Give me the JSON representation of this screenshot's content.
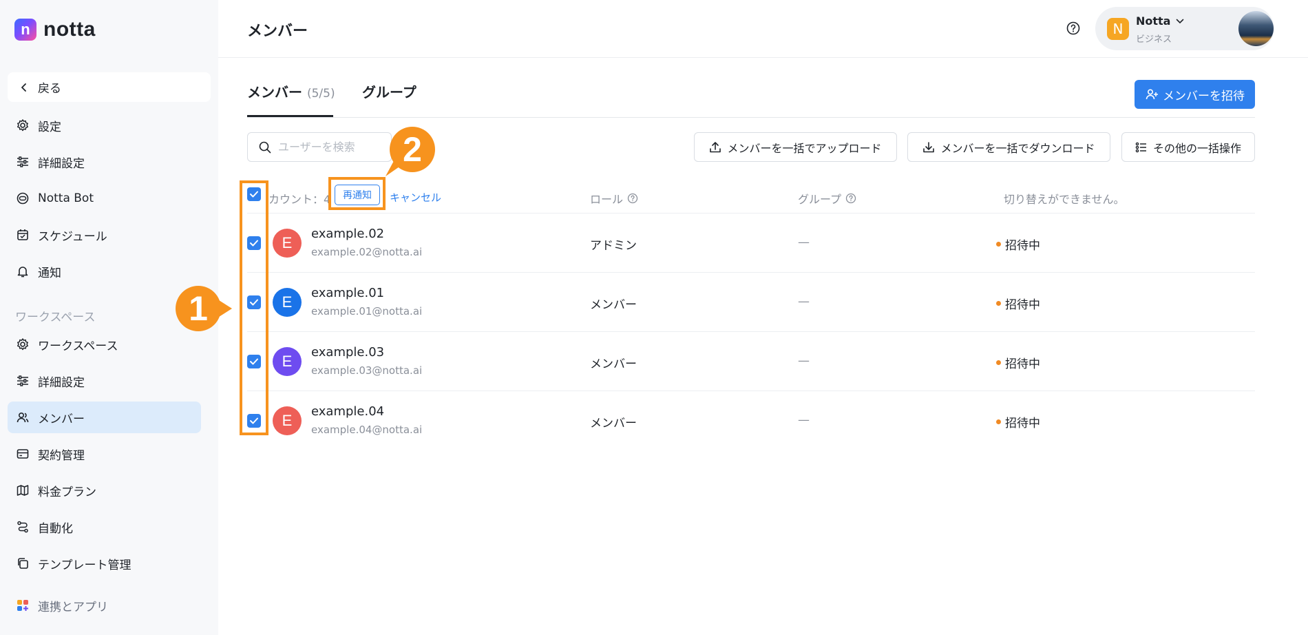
{
  "app": {
    "logo_letter": "n",
    "logo_text": "notta"
  },
  "sidebar": {
    "back_label": "戻る",
    "items": [
      {
        "label": "設定",
        "icon": "gear-icon"
      },
      {
        "label": "詳細設定",
        "icon": "sliders-icon"
      },
      {
        "label": "Notta Bot",
        "icon": "bot-icon"
      },
      {
        "label": "スケジュール",
        "icon": "calendar-icon"
      },
      {
        "label": "通知",
        "icon": "bell-icon"
      }
    ],
    "workspace_heading": "ワークスペース",
    "workspace_items": [
      {
        "label": "ワークスペース",
        "icon": "gear-icon"
      },
      {
        "label": "詳細設定",
        "icon": "sliders-icon"
      },
      {
        "label": "メンバー",
        "icon": "users-icon",
        "active": true
      },
      {
        "label": "契約管理",
        "icon": "card-icon"
      },
      {
        "label": "料金プラン",
        "icon": "map-icon"
      },
      {
        "label": "自動化",
        "icon": "flow-icon"
      },
      {
        "label": "テンプレート管理",
        "icon": "template-icon"
      }
    ],
    "integrations_label": "連携とアプリ"
  },
  "header": {
    "title": "メンバー",
    "account": {
      "name": "Notta",
      "plan": "ビジネス",
      "avatar_letter": "N"
    }
  },
  "tabs": {
    "members_label": "メンバー",
    "members_count": "(5/5)",
    "groups_label": "グループ"
  },
  "toolbar": {
    "invite_label": "メンバーを招待",
    "search_placeholder": "ユーザーを検索",
    "bulk_upload_label": "メンバーを一括でアップロード",
    "bulk_download_label": "メンバーを一括でダウンロード",
    "other_bulk_label": "その他の一括操作"
  },
  "table": {
    "selection": {
      "count_label": "カウント：4",
      "resend_label": "再通知",
      "cancel_label": "キャンセル"
    },
    "columns": {
      "role": "ロール",
      "group": "グループ",
      "status": "切り替えができません。"
    },
    "rows": [
      {
        "avatar_letter": "E",
        "avatar_color": "#ee5f57",
        "name": "example.02",
        "email": "example.02@notta.ai",
        "role": "アドミン",
        "group": "—",
        "status": "招待中"
      },
      {
        "avatar_letter": "E",
        "avatar_color": "#1a73e8",
        "name": "example.01",
        "email": "example.01@notta.ai",
        "role": "メンバー",
        "group": "—",
        "status": "招待中"
      },
      {
        "avatar_letter": "E",
        "avatar_color": "#6e4cf0",
        "name": "example.03",
        "email": "example.03@notta.ai",
        "role": "メンバー",
        "group": "—",
        "status": "招待中"
      },
      {
        "avatar_letter": "E",
        "avatar_color": "#ee5f57",
        "name": "example.04",
        "email": "example.04@notta.ai",
        "role": "メンバー",
        "group": "—",
        "status": "招待中"
      }
    ]
  },
  "annotations": {
    "badge_1": "1",
    "badge_2": "2",
    "highlight_color": "#f7931e"
  },
  "colors": {
    "accent": "#2f80ed",
    "status_pending": "#f08a24",
    "active_nav_bg": "#dcebfb"
  }
}
